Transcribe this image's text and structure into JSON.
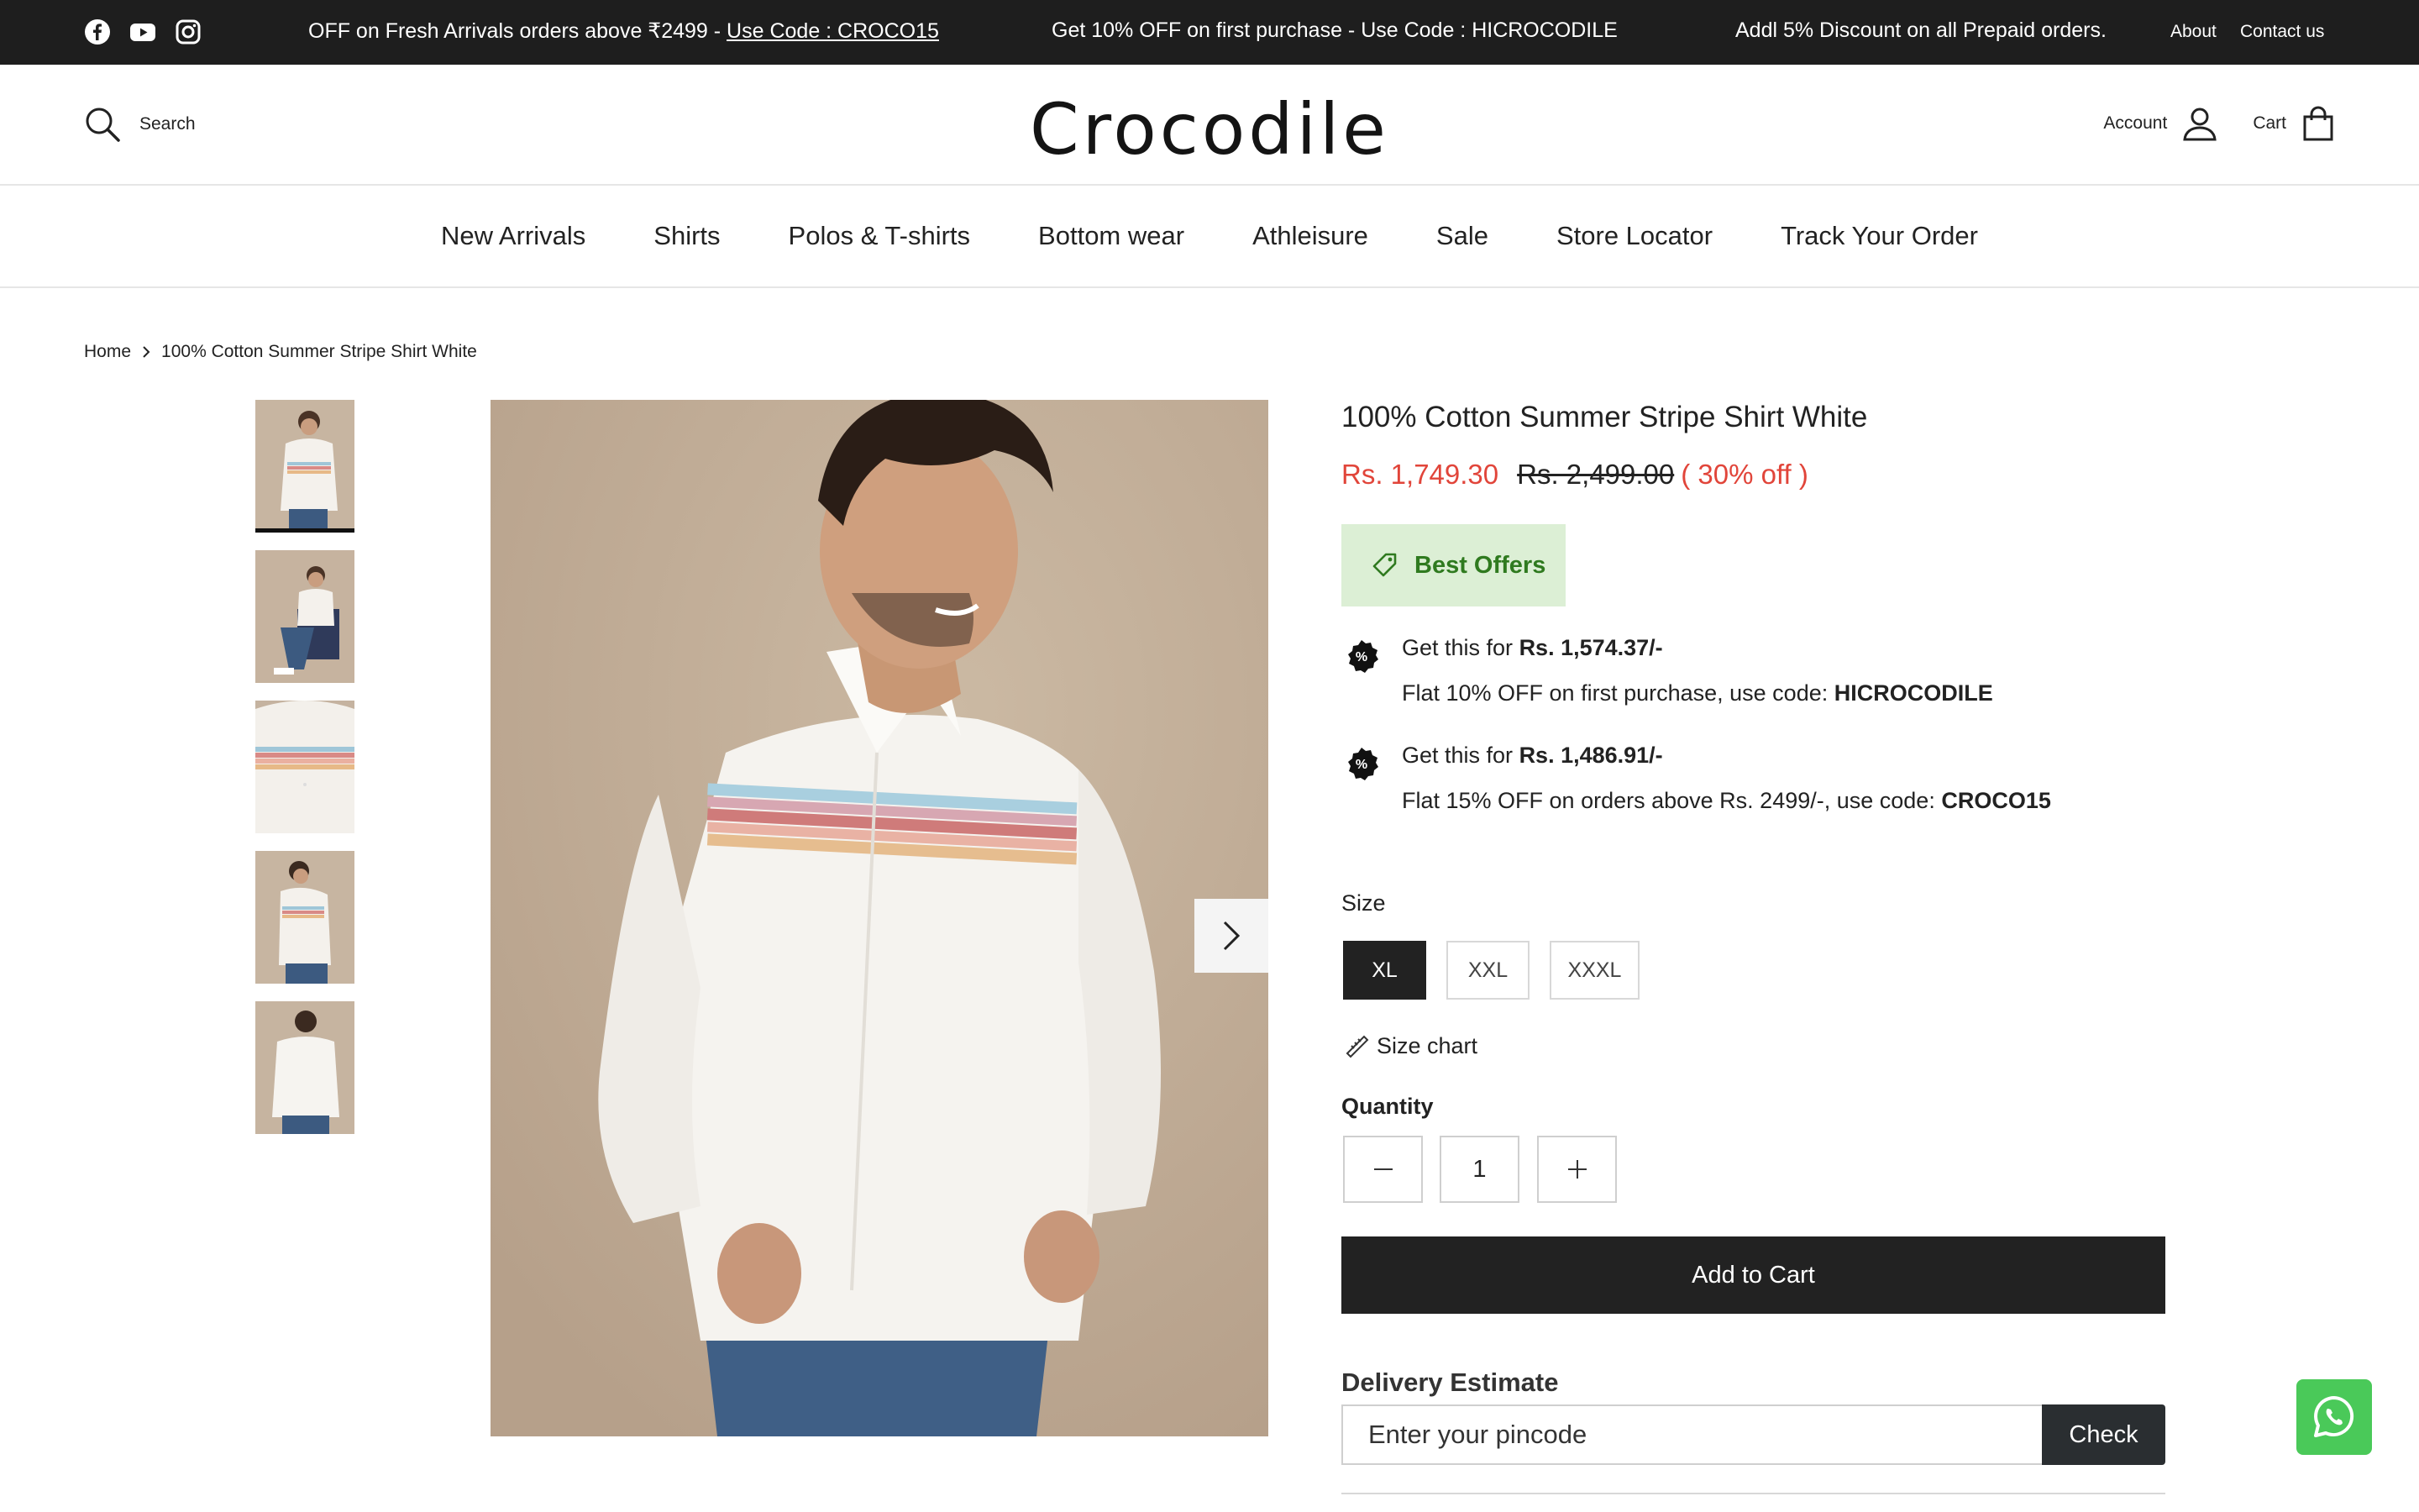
{
  "announcement": {
    "messages": [
      "OFF on Fresh Arrivals orders above ₹2499 - ",
      "Get 10% OFF on first purchase - Use Code : HICROCODILE",
      "Addl 5% Discount on all Prepaid orders."
    ],
    "code_link": "Use Code : CROCO15",
    "links": {
      "about": "About",
      "contact": "Contact us"
    },
    "social_icons": [
      "facebook-icon",
      "youtube-icon",
      "instagram-icon"
    ]
  },
  "header": {
    "search_label": "Search",
    "logo": "Crocodile",
    "account_label": "Account",
    "cart_label": "Cart"
  },
  "nav": {
    "items": [
      "New Arrivals",
      "Shirts",
      "Polos & T-shirts",
      "Bottom wear",
      "Athleisure",
      "Sale",
      "Store Locator",
      "Track Your Order"
    ]
  },
  "breadcrumb": {
    "home": "Home",
    "current": "100% Cotton Summer Stripe Shirt White"
  },
  "product": {
    "title": "100% Cotton Summer Stripe Shirt White",
    "sale_price": "Rs. 1,749.30",
    "original_price": "Rs. 2,499.00",
    "discount": "( 30% off )",
    "thumbnail_count": 5,
    "active_thumbnail": 1
  },
  "offers": {
    "badge": "Best Offers",
    "items": [
      {
        "prefix": "Get this for ",
        "price": "Rs. 1,574.37/-",
        "desc": "Flat 10% OFF on first purchase, use code: ",
        "code": "HICROCODILE"
      },
      {
        "prefix": "Get this for ",
        "price": "Rs. 1,486.91/-",
        "desc": "Flat 15% OFF on orders above Rs. 2499/-, use code: ",
        "code": "CROCO15"
      }
    ]
  },
  "size": {
    "label": "Size",
    "options": [
      "XL",
      "XXL",
      "XXXL"
    ],
    "selected": "XL",
    "chart_label": "Size chart"
  },
  "quantity": {
    "label": "Quantity",
    "value": "1",
    "minus": "−",
    "plus": "+"
  },
  "cart": {
    "add_label": "Add to Cart"
  },
  "delivery": {
    "label": "Delivery Estimate",
    "placeholder": "Enter your pincode",
    "check_label": "Check"
  },
  "colors": {
    "sale": "#e1453a",
    "offer_badge_bg": "#dcefd5",
    "offer_badge_text": "#2f7a1f",
    "dark": "#222222",
    "whatsapp": "#4ac959"
  }
}
